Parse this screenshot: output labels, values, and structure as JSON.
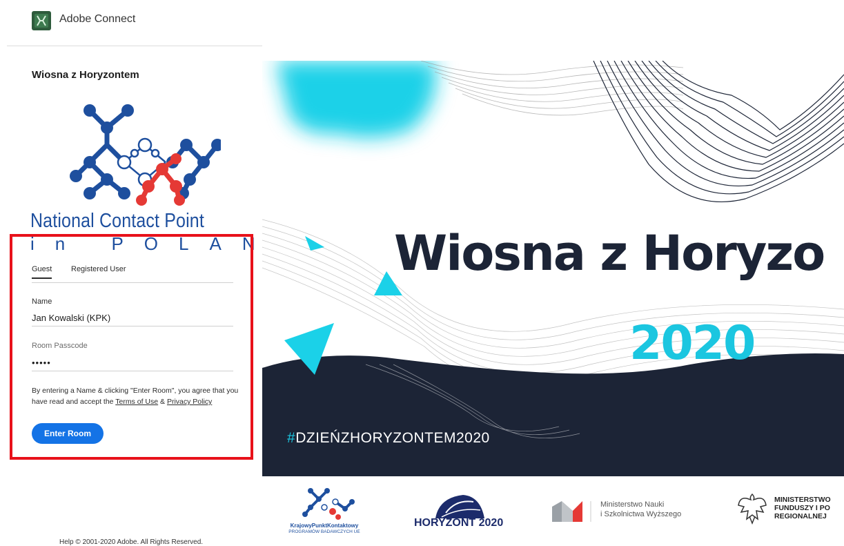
{
  "app": {
    "name": "Adobe Connect"
  },
  "room": {
    "title": "Wiosna z Horyzontem"
  },
  "ncp_logo": {
    "line1": "National Contact Point",
    "line2": "in POLAND"
  },
  "login": {
    "tabs": [
      {
        "label": "Guest",
        "active": true
      },
      {
        "label": "Registered User",
        "active": false
      }
    ],
    "name_label": "Name",
    "name_value": "Jan Kowalski (KPK)",
    "passcode_label": "Room Passcode",
    "passcode_value": "•••••",
    "agreement_prefix": "By entering a Name & clicking \"Enter Room\", you agree that you have read and accept the ",
    "terms_link": "Terms of Use",
    "agreement_and": " & ",
    "privacy_link": "Privacy Policy",
    "enter_button": "Enter Room"
  },
  "banner": {
    "title": "Wiosna z Horyzo",
    "year": "2020",
    "hashtag_symbol": "#",
    "hashtag_text": "DZIEŃZHORYZONTEM2020"
  },
  "partners": {
    "kpk_line1": "KrajowyPunktKontaktowy",
    "kpk_line2": "PROGRAMÓW BADAWCZYCH UE",
    "horyzont": "HORYZONT 2020",
    "ministry_science_line1": "Ministerstwo Nauki",
    "ministry_science_line2": "i Szkolnictwa Wyższego",
    "ministry_funds_line1": "MINISTERSTWO",
    "ministry_funds_line2": "FUNDUSZY I PO",
    "ministry_funds_line3": "REGIONALNEJ"
  },
  "footer": {
    "text": "Help © 2001-2020 Adobe. All Rights Reserved."
  },
  "colors": {
    "accent_blue": "#1473e6",
    "highlight_red": "#e8111a",
    "banner_dark": "#1c2436",
    "banner_cyan": "#1bc6e0",
    "ncp_blue": "#1e4f9e",
    "ncp_red": "#e53935"
  }
}
